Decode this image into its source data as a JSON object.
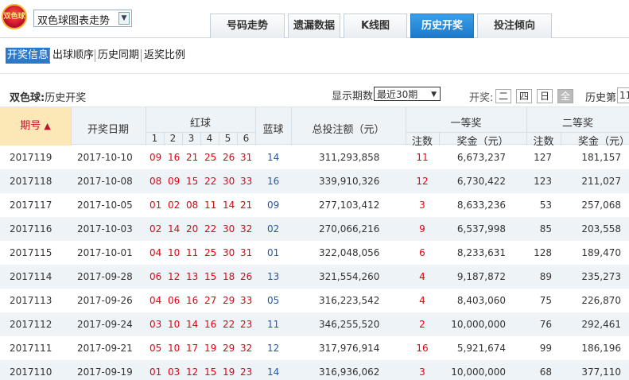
{
  "header": {
    "logo_text": "双色球",
    "lottery_select": "双色球图表走势",
    "tabs": [
      {
        "label": "号码走势"
      },
      {
        "label": "遗漏数据"
      },
      {
        "label": "K线图"
      },
      {
        "label": "历史开奖"
      },
      {
        "label": "投注倾向"
      }
    ],
    "active_tab": "历史开奖"
  },
  "submenu": [
    "开奖信息",
    "出球顺序",
    "历史同期",
    "返奖比例"
  ],
  "filter": {
    "title_bold": "双色球:",
    "title_rest": "历史开奖",
    "period_label": "显示期数",
    "period_value": "最近30期",
    "draw_label": "开奖:",
    "days": [
      "二",
      "四",
      "日",
      "全"
    ],
    "history_label": "历史第",
    "history_value": "11"
  },
  "table": {
    "headers": {
      "issue": "期号",
      "date": "开奖日期",
      "red": "红球",
      "red_positions": [
        "1",
        "2",
        "3",
        "4",
        "5",
        "6"
      ],
      "blue": "蓝球",
      "total": "总投注额（元）",
      "first": "一等奖",
      "second": "二等奖",
      "notes": "注数",
      "prize": "奖金（元）"
    },
    "rows": [
      {
        "issue": "2017119",
        "date": "2017-10-10",
        "red": [
          "09",
          "16",
          "21",
          "25",
          "26",
          "31"
        ],
        "blue": "14",
        "total": "311,293,858",
        "first_n": "11",
        "first_p": "6,673,237",
        "second_n": "127",
        "second_p": "181,157"
      },
      {
        "issue": "2017118",
        "date": "2017-10-08",
        "red": [
          "08",
          "09",
          "15",
          "22",
          "30",
          "33"
        ],
        "blue": "16",
        "total": "339,910,326",
        "first_n": "12",
        "first_p": "6,730,422",
        "second_n": "123",
        "second_p": "211,027"
      },
      {
        "issue": "2017117",
        "date": "2017-10-05",
        "red": [
          "01",
          "02",
          "08",
          "11",
          "14",
          "21"
        ],
        "blue": "09",
        "total": "277,103,412",
        "first_n": "3",
        "first_p": "8,633,236",
        "second_n": "53",
        "second_p": "257,068"
      },
      {
        "issue": "2017116",
        "date": "2017-10-03",
        "red": [
          "02",
          "14",
          "20",
          "22",
          "30",
          "32"
        ],
        "blue": "02",
        "total": "270,066,216",
        "first_n": "9",
        "first_p": "6,537,998",
        "second_n": "85",
        "second_p": "203,558"
      },
      {
        "issue": "2017115",
        "date": "2017-10-01",
        "red": [
          "04",
          "10",
          "11",
          "25",
          "30",
          "31"
        ],
        "blue": "01",
        "total": "322,048,056",
        "first_n": "6",
        "first_p": "8,233,631",
        "second_n": "128",
        "second_p": "189,470"
      },
      {
        "issue": "2017114",
        "date": "2017-09-28",
        "red": [
          "06",
          "12",
          "13",
          "15",
          "18",
          "26"
        ],
        "blue": "13",
        "total": "321,554,260",
        "first_n": "4",
        "first_p": "9,187,872",
        "second_n": "89",
        "second_p": "235,273"
      },
      {
        "issue": "2017113",
        "date": "2017-09-26",
        "red": [
          "04",
          "06",
          "16",
          "27",
          "29",
          "33"
        ],
        "blue": "05",
        "total": "316,223,542",
        "first_n": "4",
        "first_p": "8,403,060",
        "second_n": "75",
        "second_p": "226,870"
      },
      {
        "issue": "2017112",
        "date": "2017-09-24",
        "red": [
          "03",
          "10",
          "14",
          "16",
          "22",
          "23"
        ],
        "blue": "11",
        "total": "346,255,520",
        "first_n": "2",
        "first_p": "10,000,000",
        "second_n": "76",
        "second_p": "292,461"
      },
      {
        "issue": "2017111",
        "date": "2017-09-21",
        "red": [
          "05",
          "10",
          "17",
          "19",
          "29",
          "32"
        ],
        "blue": "12",
        "total": "317,976,914",
        "first_n": "16",
        "first_p": "5,921,674",
        "second_n": "99",
        "second_p": "186,196"
      },
      {
        "issue": "2017110",
        "date": "2017-09-19",
        "red": [
          "01",
          "03",
          "12",
          "15",
          "19",
          "23"
        ],
        "blue": "14",
        "total": "316,936,062",
        "first_n": "3",
        "first_p": "10,000,000",
        "second_n": "68",
        "second_p": "377,110"
      }
    ]
  },
  "colors": {
    "accent": "#1c78c9",
    "red_ball": "#e60012",
    "blue_ball": "#2458a6",
    "alt_row": "#eef3f8"
  }
}
